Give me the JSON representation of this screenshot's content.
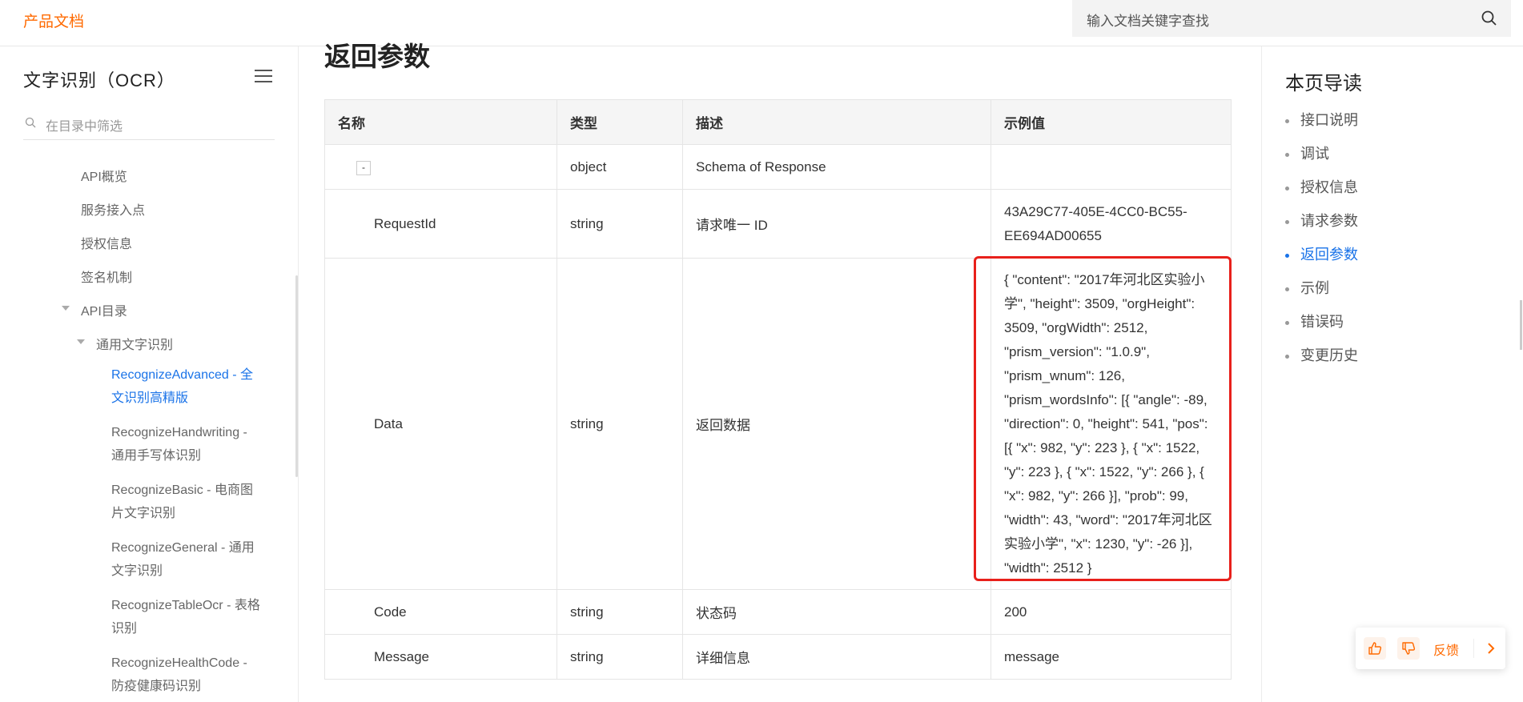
{
  "header": {
    "brand": "产品文档",
    "search_placeholder": "输入文档关键字查找"
  },
  "sidebar": {
    "title": "文字识别（OCR）",
    "filter_placeholder": "在目录中筛选",
    "items": [
      {
        "label": "API概览"
      },
      {
        "label": "服务接入点"
      },
      {
        "label": "授权信息"
      },
      {
        "label": "签名机制"
      },
      {
        "label": "API目录"
      },
      {
        "label": "通用文字识别"
      },
      {
        "label": "RecognizeAdvanced - 全文识别高精版"
      },
      {
        "label": "RecognizeHandwriting - 通用手写体识别"
      },
      {
        "label": "RecognizeBasic - 电商图片文字识别"
      },
      {
        "label": "RecognizeGeneral - 通用文字识别"
      },
      {
        "label": "RecognizeTableOcr - 表格识别"
      },
      {
        "label": "RecognizeHealthCode - 防疫健康码识别"
      }
    ]
  },
  "main": {
    "section_title": "返回参数",
    "table": {
      "headers": [
        "名称",
        "类型",
        "描述",
        "示例值"
      ],
      "rows": [
        {
          "name": "-",
          "type": "object",
          "desc": "Schema of Response",
          "example": ""
        },
        {
          "name": "RequestId",
          "type": "string",
          "desc": "请求唯一 ID",
          "example": "43A29C77-405E-4CC0-BC55-EE694AD00655"
        },
        {
          "name": "Data",
          "type": "string",
          "desc": "返回数据",
          "example": "{ \"content\": \"2017年河北区实验小学\", \"height\": 3509, \"orgHeight\": 3509, \"orgWidth\": 2512, \"prism_version\": \"1.0.9\", \"prism_wnum\": 126, \"prism_wordsInfo\": [{ \"angle\": -89, \"direction\": 0, \"height\": 541, \"pos\": [{ \"x\": 982, \"y\": 223 }, { \"x\": 1522, \"y\": 223 }, { \"x\": 1522, \"y\": 266 }, { \"x\": 982, \"y\": 266 }], \"prob\": 99, \"width\": 43, \"word\": \"2017年河北区实验小学\", \"x\": 1230, \"y\": -26 }], \"width\": 2512 }"
        },
        {
          "name": "Code",
          "type": "string",
          "desc": "状态码",
          "example": "200"
        },
        {
          "name": "Message",
          "type": "string",
          "desc": "详细信息",
          "example": "message"
        }
      ]
    },
    "highlight_color": "#e8201b"
  },
  "toc": {
    "title": "本页导读",
    "items": [
      {
        "label": "接口说明"
      },
      {
        "label": "调试"
      },
      {
        "label": "授权信息"
      },
      {
        "label": "请求参数"
      },
      {
        "label": "返回参数"
      },
      {
        "label": "示例"
      },
      {
        "label": "错误码"
      },
      {
        "label": "变更历史"
      }
    ]
  },
  "feedback": {
    "label": "反馈",
    "like_icon": "thumbs-up-icon",
    "dislike_icon": "thumbs-down-icon"
  },
  "colors": {
    "accent": "#ff6a00",
    "link": "#1a73e8"
  }
}
